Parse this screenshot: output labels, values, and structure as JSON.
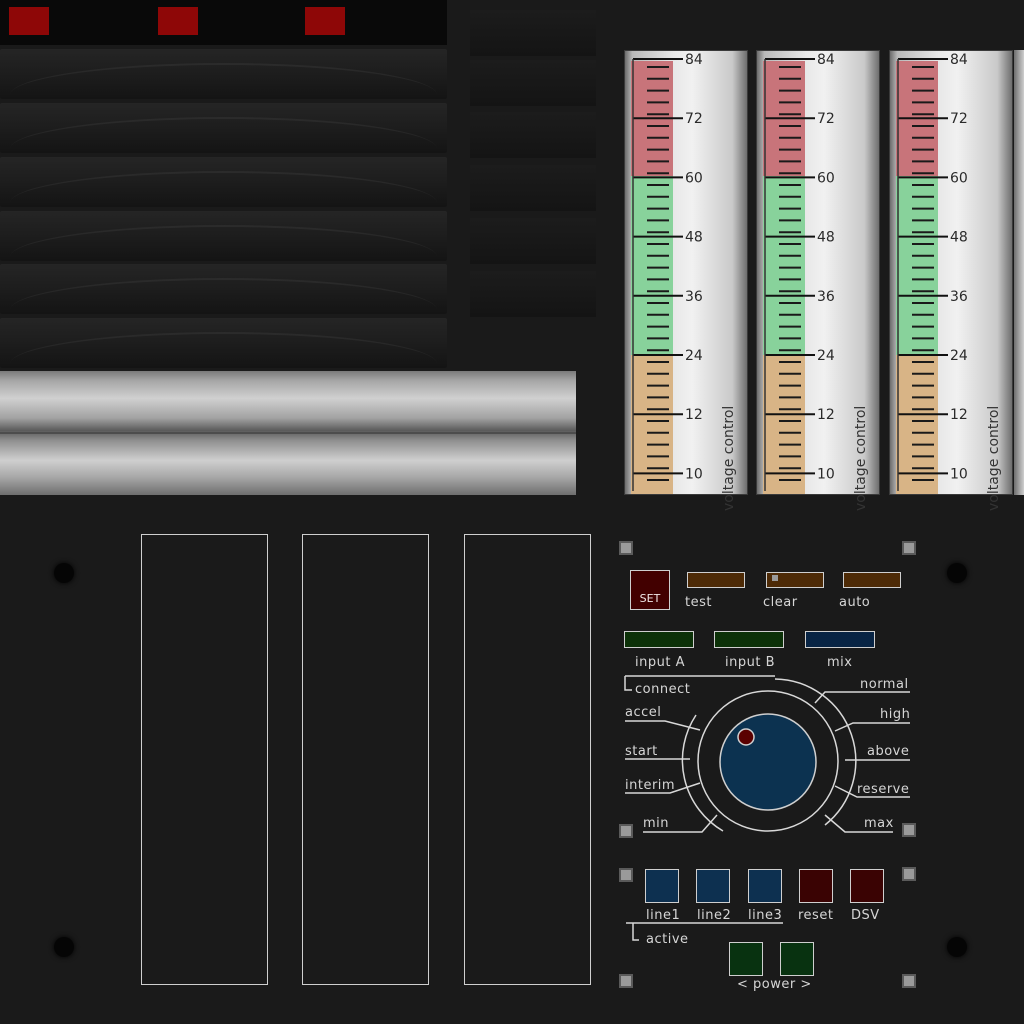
{
  "meter": {
    "ticks": [
      "84",
      "72",
      "60",
      "48",
      "36",
      "24",
      "12",
      "10"
    ],
    "label": "voltage control",
    "zones": {
      "red": "#c8747a",
      "green": "#88d29b",
      "tan": "#d8b486"
    }
  },
  "controls": {
    "set_label": "SET",
    "row1": [
      "test",
      "clear",
      "auto"
    ],
    "row2": [
      "input A",
      "input B",
      "mix"
    ],
    "connect_label": "connect",
    "dial_left": [
      "accel",
      "start",
      "interim",
      "min"
    ],
    "dial_right": [
      "normal",
      "high",
      "above",
      "reserve",
      "max"
    ],
    "squares": [
      "line1",
      "line2",
      "line3",
      "reset",
      "DSV"
    ],
    "active_label": "active",
    "power_label": "< power >"
  },
  "colors": {
    "knob": "#0c3250",
    "indicator": "#5a0000",
    "brown_button": "#4d2a06",
    "green_button": "#0c3108",
    "navy_button": "#082444"
  }
}
